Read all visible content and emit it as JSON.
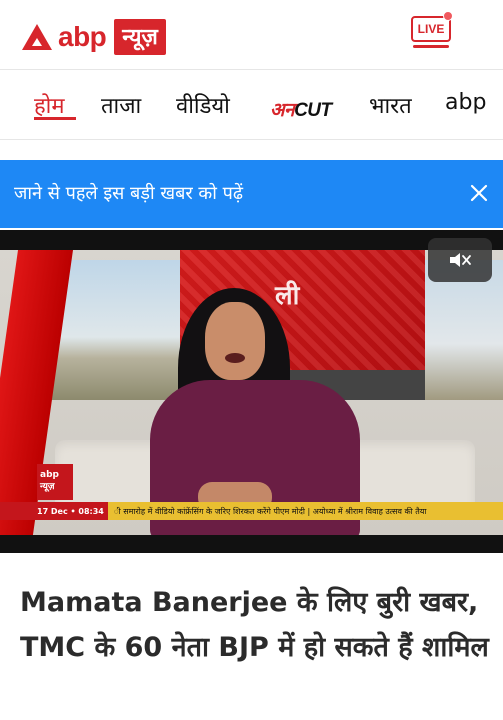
{
  "header": {
    "logo": {
      "brand": "abp",
      "sub": "न्यूज़",
      "icon": "abp-triangle-logo"
    },
    "live_label": "LIVE",
    "colors": {
      "brand_red": "#d7262c"
    }
  },
  "nav": {
    "items": [
      {
        "label": "होम",
        "active": true
      },
      {
        "label": "ताजा",
        "active": false
      },
      {
        "label": "वीडियो",
        "active": false
      },
      {
        "label_a": "अन",
        "label_b": "CUT",
        "active": false
      },
      {
        "label": "भारत",
        "active": false
      },
      {
        "label": "abp",
        "active": false
      }
    ]
  },
  "banner": {
    "text": "जाने से पहले इस बड़ी खबर को पढ़ें",
    "close_icon": "close-icon",
    "color": "#1e88f5"
  },
  "video": {
    "mute_icon": "mute-icon",
    "channel_logo": {
      "line1": "abp",
      "line2": "न्यूज़"
    },
    "ticker": {
      "date": "17 Dec • 08:34",
      "text": "ी समारोह में वीडियो कांफ्रेंसिंग के जरिए शिरकत करेंगे पीएम मोदी  |  अयोध्या में श्रीराम विवाह उत्सव की तैया"
    },
    "panel_text": "ली"
  },
  "article": {
    "headline": "Mamata Banerjee के लिए बुरी खबर, TMC के 60 नेता BJP में हो सकते हैं शामिल"
  }
}
